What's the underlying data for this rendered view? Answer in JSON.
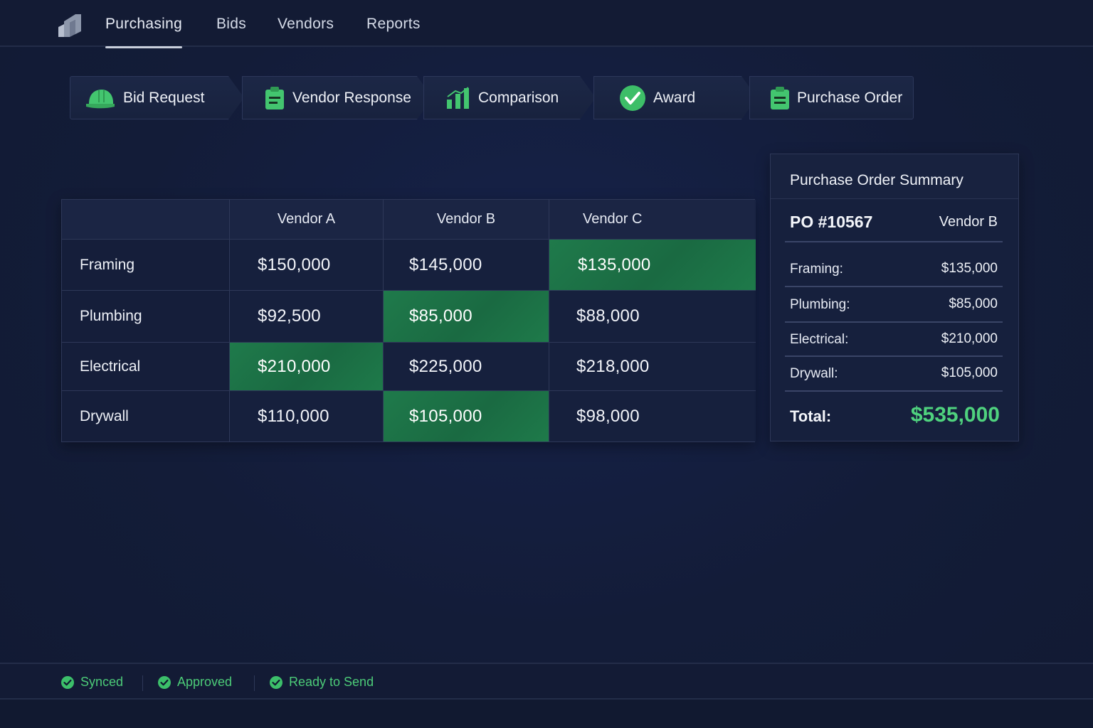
{
  "nav": {
    "logo_icon": "building-logo",
    "tabs": [
      {
        "label": "Purchasing",
        "active": true
      },
      {
        "label": "Bids",
        "active": false
      },
      {
        "label": "Vendors",
        "active": false
      },
      {
        "label": "Reports",
        "active": false
      }
    ]
  },
  "stepper": [
    {
      "label": "Bid Request",
      "icon": "hard-hat-icon"
    },
    {
      "label": "Vendor Response",
      "icon": "clipboard-icon"
    },
    {
      "label": "Comparison",
      "icon": "bar-chart-icon"
    },
    {
      "label": "Award",
      "icon": "check-circle-icon"
    },
    {
      "label": "Purchase Order",
      "icon": "clipboard-list-icon"
    }
  ],
  "comparison": {
    "columns": [
      "Vendor A",
      "Vendor B",
      "Vendor C"
    ],
    "rows": [
      {
        "label": "Framing",
        "values": [
          "$150,000",
          "$145,000",
          "$135,000"
        ],
        "best": 2
      },
      {
        "label": "Plumbing",
        "values": [
          "$92,500",
          "$85,000",
          "$88,000"
        ],
        "best": 1
      },
      {
        "label": "Electrical",
        "values": [
          "$210,000",
          "$225,000",
          "$218,000"
        ],
        "best": 0
      },
      {
        "label": "Drywall",
        "values": [
          "$110,000",
          "$105,000",
          "$98,000"
        ],
        "best": 1
      }
    ]
  },
  "summary": {
    "title": "Purchase Order Summary",
    "po_number": "PO #10567",
    "vendor": "Vendor B",
    "items": [
      {
        "label": "Framing:",
        "value": "$135,000"
      },
      {
        "label": "Plumbing:",
        "value": "$85,000"
      },
      {
        "label": "Electrical:",
        "value": "$210,000"
      },
      {
        "label": "Drywall:",
        "value": "$105,000"
      }
    ],
    "total_label": "Total:",
    "total_value": "$535,000"
  },
  "status": [
    {
      "label": "Synced",
      "icon": "check-circle-icon"
    },
    {
      "label": "Approved",
      "icon": "check-circle-icon"
    },
    {
      "label": "Ready to Send",
      "icon": "check-circle-icon"
    }
  ],
  "colors": {
    "accent_green": "#4fd27e",
    "best_cell": "#1f7a4b",
    "background": "#141d38"
  }
}
